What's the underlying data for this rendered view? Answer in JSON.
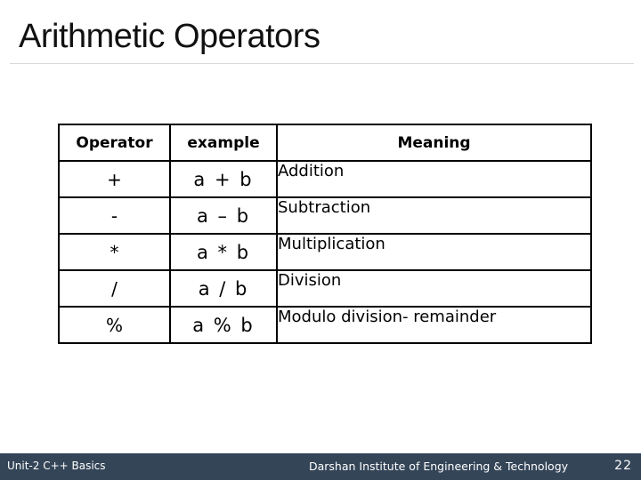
{
  "slide": {
    "title": "Arithmetic Operators"
  },
  "table": {
    "headers": [
      "Operator",
      "example",
      "Meaning"
    ],
    "rows": [
      {
        "operator": "+",
        "example": "a + b",
        "meaning": "Addition"
      },
      {
        "operator": "-",
        "example": "a – b",
        "meaning": "Subtraction"
      },
      {
        "operator": "*",
        "example": "a * b",
        "meaning": "Multiplication"
      },
      {
        "operator": "/",
        "example": "a / b",
        "meaning": "Division"
      },
      {
        "operator": "%",
        "example": "a % b",
        "meaning": "Modulo division- remainder"
      }
    ]
  },
  "footer": {
    "unit": "Unit-2 C++ Basics",
    "institute": "Darshan Institute of Engineering & Technology",
    "page_number": "22",
    "background_color": "#344558"
  }
}
